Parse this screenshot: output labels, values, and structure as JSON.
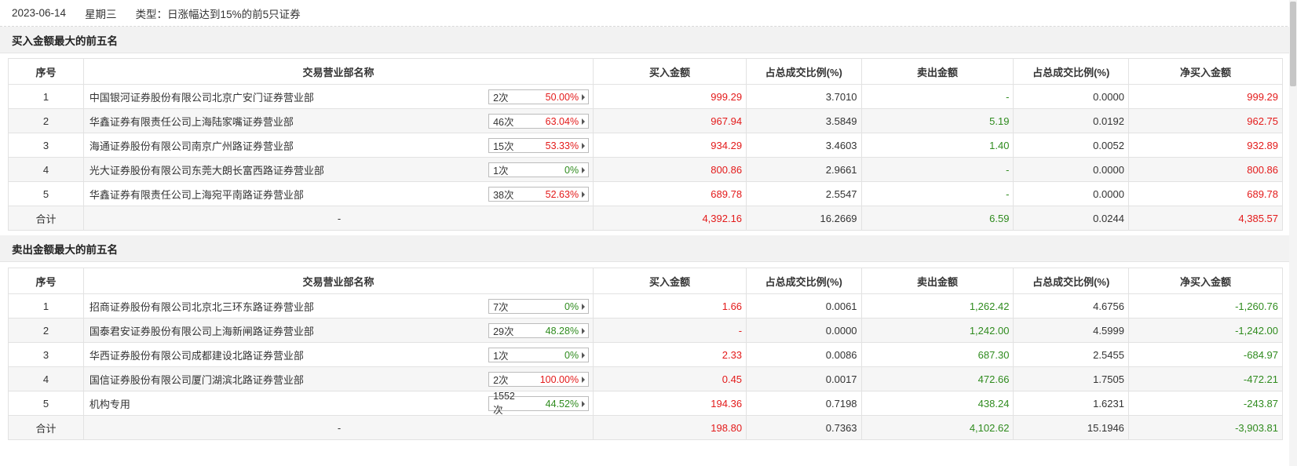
{
  "top": {
    "date": "2023-06-14",
    "weekday": "星期三",
    "type_label": "类型：",
    "type_value": "日涨幅达到15%的前5只证券"
  },
  "columns": [
    "序号",
    "交易营业部名称",
    "买入金额",
    "占总成交比例(%)",
    "卖出金额",
    "占总成交比例(%)",
    "净买入金额"
  ],
  "buy_section": {
    "title": "买入金额最大的前五名",
    "rows": [
      {
        "idx": "1",
        "name": "中国银河证券股份有限公司北京广安门证券营业部",
        "times": "2次",
        "rate": "50.00%",
        "rate_color": "red",
        "buy": "999.29",
        "buy_ratio": "3.7010",
        "sell": "-",
        "sell_ratio": "0.0000",
        "net": "999.29",
        "net_color": "red"
      },
      {
        "idx": "2",
        "name": "华鑫证券有限责任公司上海陆家嘴证券营业部",
        "times": "46次",
        "rate": "63.04%",
        "rate_color": "red",
        "buy": "967.94",
        "buy_ratio": "3.5849",
        "sell": "5.19",
        "sell_ratio": "0.0192",
        "net": "962.75",
        "net_color": "red"
      },
      {
        "idx": "3",
        "name": "海通证券股份有限公司南京广州路证券营业部",
        "times": "15次",
        "rate": "53.33%",
        "rate_color": "red",
        "buy": "934.29",
        "buy_ratio": "3.4603",
        "sell": "1.40",
        "sell_ratio": "0.0052",
        "net": "932.89",
        "net_color": "red"
      },
      {
        "idx": "4",
        "name": "光大证券股份有限公司东莞大朗长富西路证券营业部",
        "times": "1次",
        "rate": "0%",
        "rate_color": "green",
        "buy": "800.86",
        "buy_ratio": "2.9661",
        "sell": "-",
        "sell_ratio": "0.0000",
        "net": "800.86",
        "net_color": "red"
      },
      {
        "idx": "5",
        "name": "华鑫证券有限责任公司上海宛平南路证券营业部",
        "times": "38次",
        "rate": "52.63%",
        "rate_color": "red",
        "buy": "689.78",
        "buy_ratio": "2.5547",
        "sell": "-",
        "sell_ratio": "0.0000",
        "net": "689.78",
        "net_color": "red"
      }
    ],
    "total": {
      "label": "合计",
      "name": "-",
      "buy": "4,392.16",
      "buy_ratio": "16.2669",
      "sell": "6.59",
      "sell_ratio": "0.0244",
      "net": "4,385.57",
      "net_color": "red"
    }
  },
  "sell_section": {
    "title": "卖出金额最大的前五名",
    "rows": [
      {
        "idx": "1",
        "name": "招商证券股份有限公司北京北三环东路证券营业部",
        "times": "7次",
        "rate": "0%",
        "rate_color": "green",
        "buy": "1.66",
        "buy_ratio": "0.0061",
        "sell": "1,262.42",
        "sell_ratio": "4.6756",
        "net": "-1,260.76",
        "net_color": "green"
      },
      {
        "idx": "2",
        "name": "国泰君安证券股份有限公司上海新闸路证券营业部",
        "times": "29次",
        "rate": "48.28%",
        "rate_color": "green",
        "buy": "-",
        "buy_ratio": "0.0000",
        "sell": "1,242.00",
        "sell_ratio": "4.5999",
        "net": "-1,242.00",
        "net_color": "green"
      },
      {
        "idx": "3",
        "name": "华西证券股份有限公司成都建设北路证券营业部",
        "times": "1次",
        "rate": "0%",
        "rate_color": "green",
        "buy": "2.33",
        "buy_ratio": "0.0086",
        "sell": "687.30",
        "sell_ratio": "2.5455",
        "net": "-684.97",
        "net_color": "green"
      },
      {
        "idx": "4",
        "name": "国信证券股份有限公司厦门湖滨北路证券营业部",
        "times": "2次",
        "rate": "100.00%",
        "rate_color": "red",
        "buy": "0.45",
        "buy_ratio": "0.0017",
        "sell": "472.66",
        "sell_ratio": "1.7505",
        "net": "-472.21",
        "net_color": "green"
      },
      {
        "idx": "5",
        "name": "机构专用",
        "times": "1552次",
        "rate": "44.52%",
        "rate_color": "green",
        "buy": "194.36",
        "buy_ratio": "0.7198",
        "sell": "438.24",
        "sell_ratio": "1.6231",
        "net": "-243.87",
        "net_color": "green"
      }
    ],
    "total": {
      "label": "合计",
      "name": "-",
      "buy": "198.80",
      "buy_ratio": "0.7363",
      "sell": "4,102.62",
      "sell_ratio": "15.1946",
      "net": "-3,903.81",
      "net_color": "green"
    }
  },
  "colors": {
    "red": "#e31a1a",
    "green": "#2f8b1e",
    "header_bg": "#f2f2f2",
    "row_alt": "#f6f6f6"
  }
}
